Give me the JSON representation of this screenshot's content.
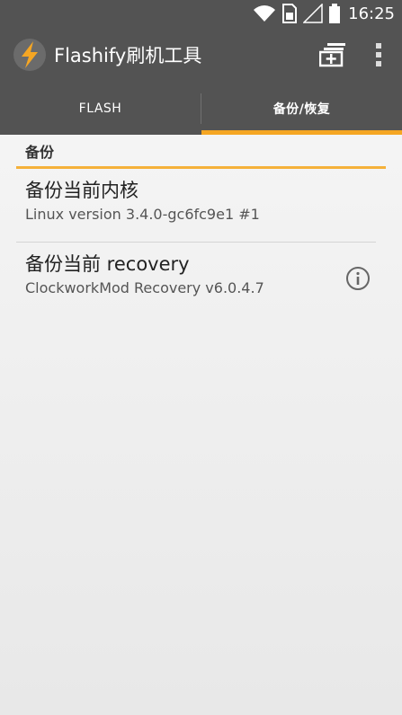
{
  "status_bar": {
    "time": "16:25",
    "icons": [
      "wifi-icon",
      "sim-icon",
      "signal-icon",
      "battery-icon"
    ]
  },
  "action_bar": {
    "title": "Flashify刷机工具",
    "logo_icon": "lightning-bolt-icon",
    "actions": [
      "add-queue-icon",
      "overflow-menu-icon"
    ]
  },
  "tabs": [
    {
      "label": "FLASH",
      "active": false
    },
    {
      "label": "备份/恢复",
      "active": true
    }
  ],
  "section": {
    "header": "备份"
  },
  "items": [
    {
      "title": "备份当前内核",
      "subtitle": "Linux version 3.4.0-gc6fc9e1 #1"
    },
    {
      "title": "备份当前 recovery",
      "subtitle": "ClockworkMod Recovery v6.0.4.7",
      "action_icon": "info-icon"
    }
  ],
  "colors": {
    "bar": "#535353",
    "accent": "#f5a623",
    "logo_bg": "#6b6b6b"
  }
}
